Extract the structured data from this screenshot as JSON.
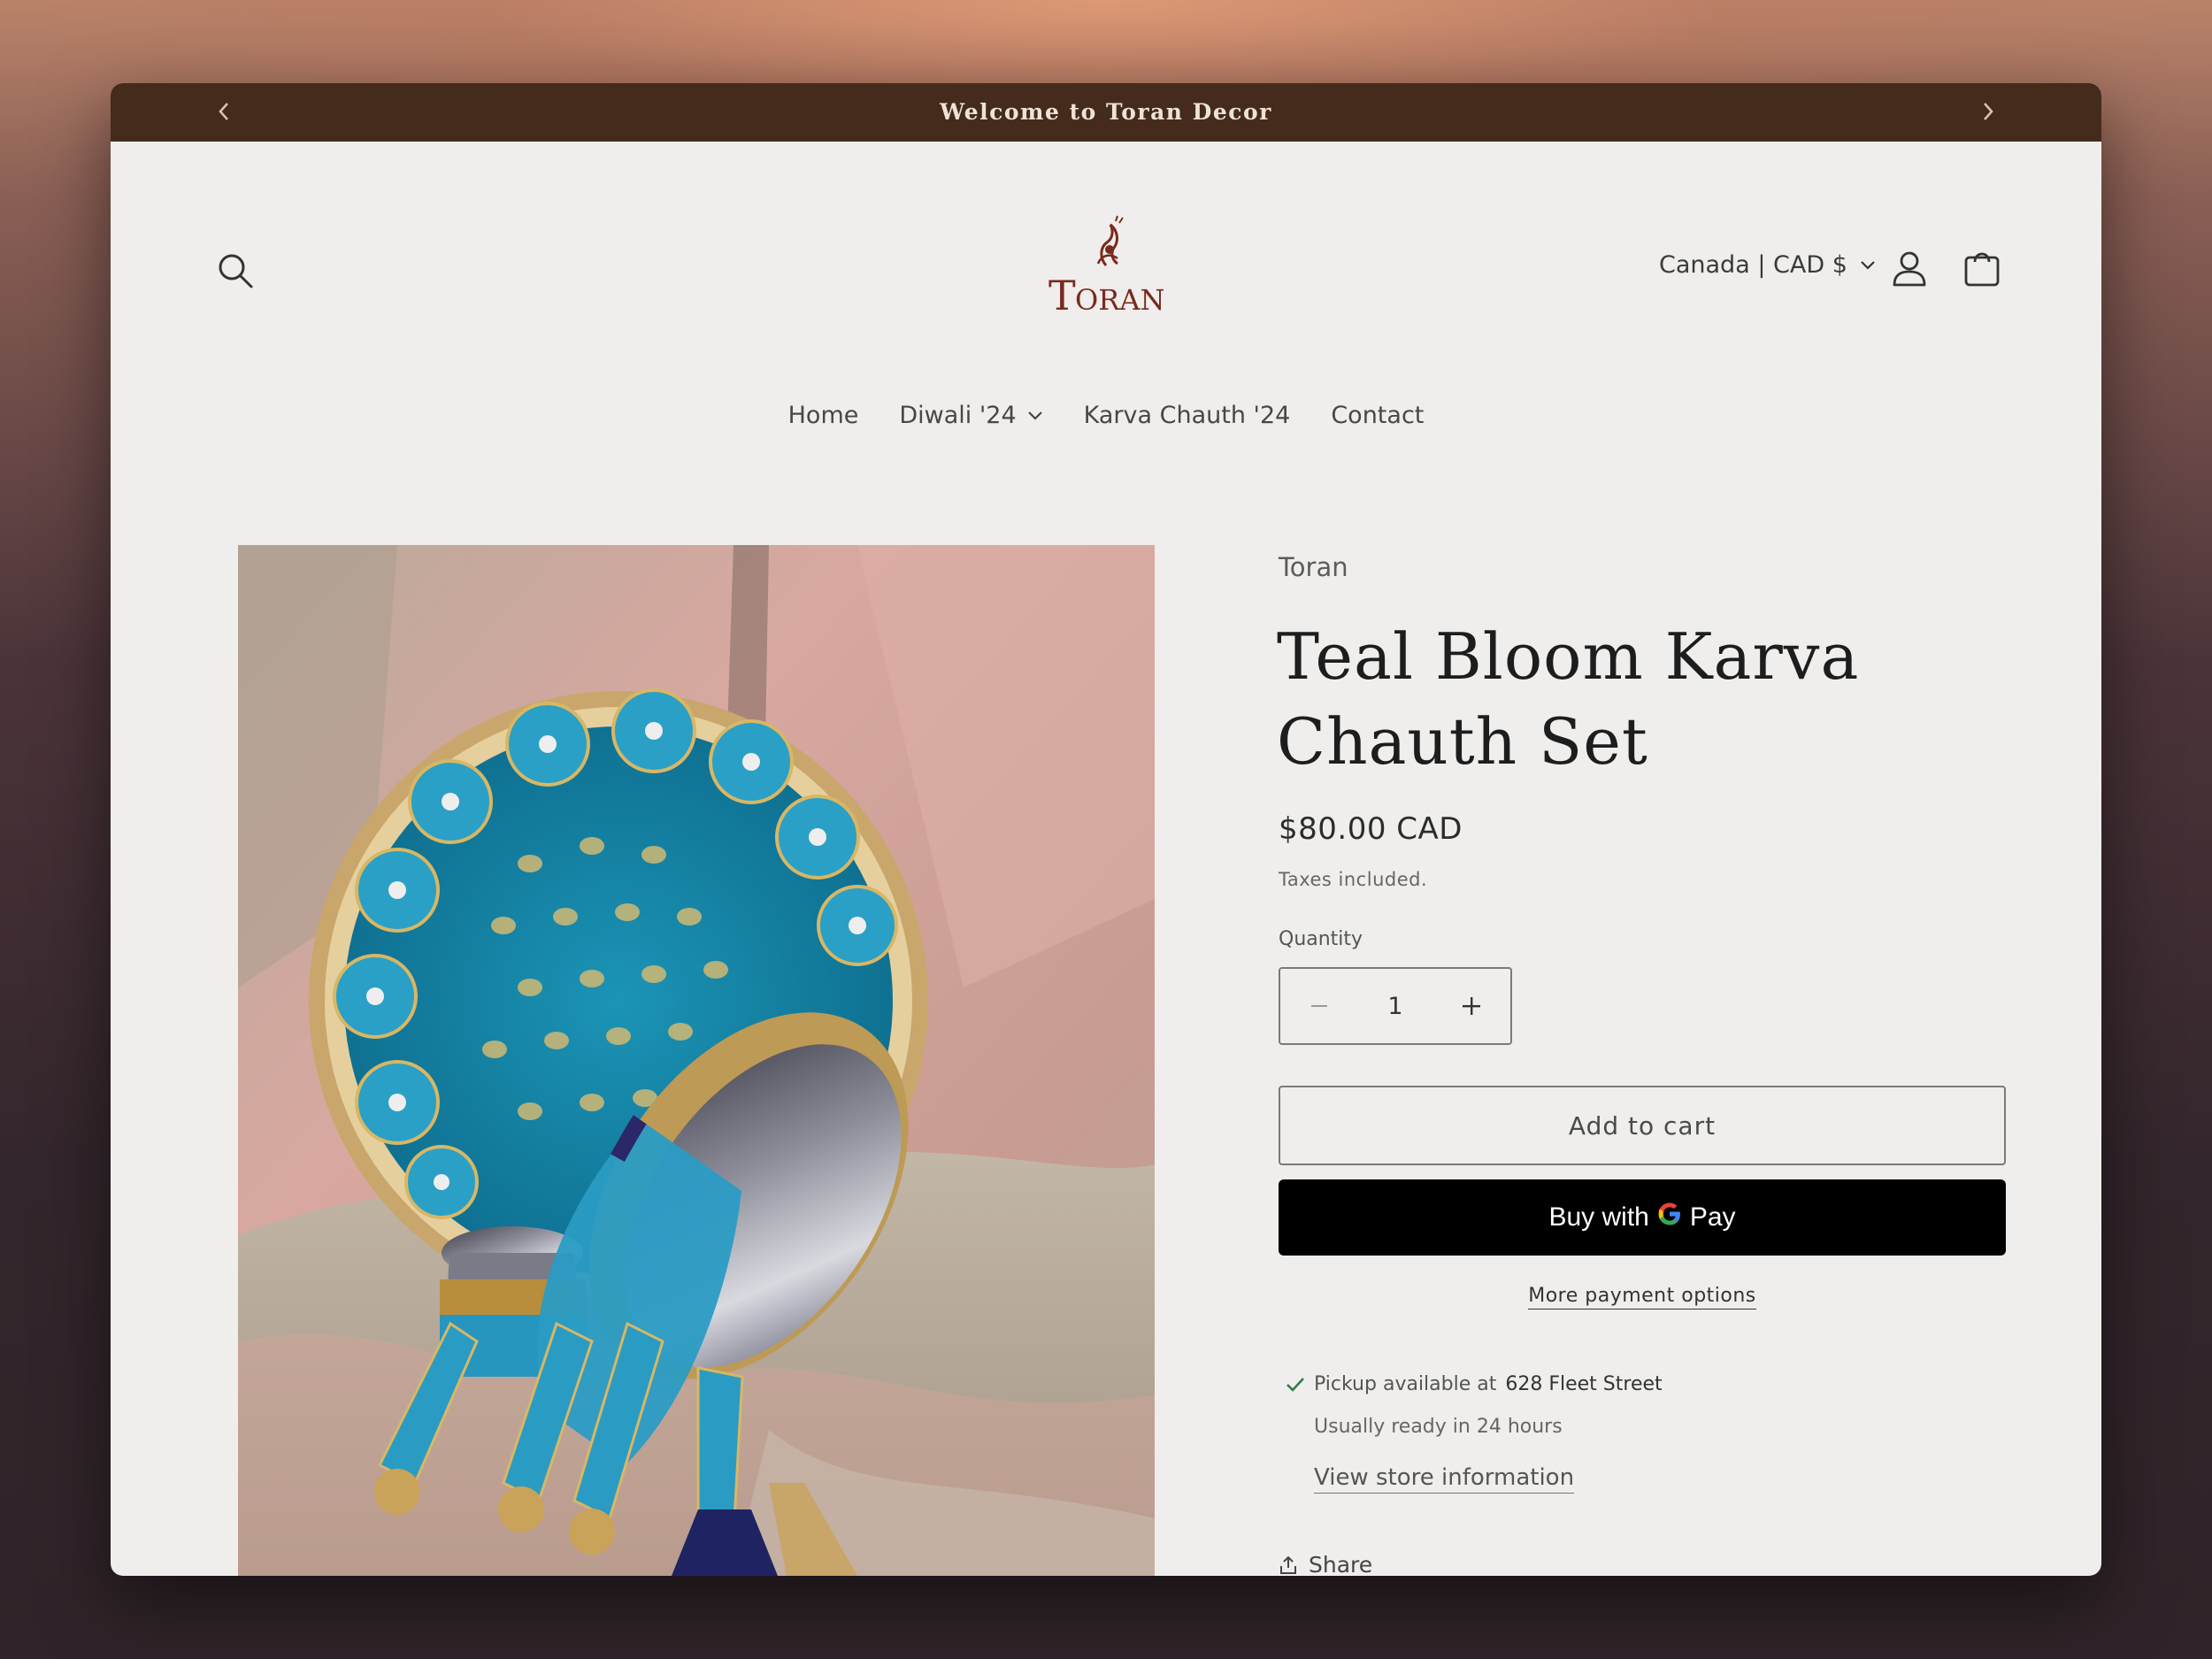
{
  "announcement": {
    "text": "Welcome to Toran Decor",
    "prev_icon": "chevron-left-icon",
    "next_icon": "chevron-right-icon"
  },
  "header": {
    "logo_text": "TORAN",
    "country_selector": "Canada | CAD $",
    "icons": [
      "search-icon",
      "account-icon",
      "cart-icon"
    ]
  },
  "nav": {
    "items": [
      {
        "label": "Home"
      },
      {
        "label": "Diwali '24"
      },
      {
        "label": "Karva Chauth '24"
      },
      {
        "label": "Contact"
      }
    ]
  },
  "product": {
    "vendor": "Toran",
    "title": "Teal Bloom Karva Chauth Set",
    "price": "$80.00 CAD",
    "taxes_note": "Taxes included.",
    "quantity_label": "Quantity",
    "quantity_value": "1",
    "add_to_cart": "Add to cart",
    "buy_with": "Buy with",
    "pay_label": "Pay",
    "more_payment": "More payment options",
    "pickup_prefix": "Pickup available at",
    "pickup_location": "628 Fleet Street",
    "pickup_ready": "Usually ready in 24 hours",
    "store_info": "View store information",
    "share": "Share"
  },
  "colors": {
    "announcement_bg": "#452b1c",
    "page_bg": "#efeeec",
    "logo_red": "#7a2a1e",
    "pickup_check": "#2e7d4f"
  }
}
